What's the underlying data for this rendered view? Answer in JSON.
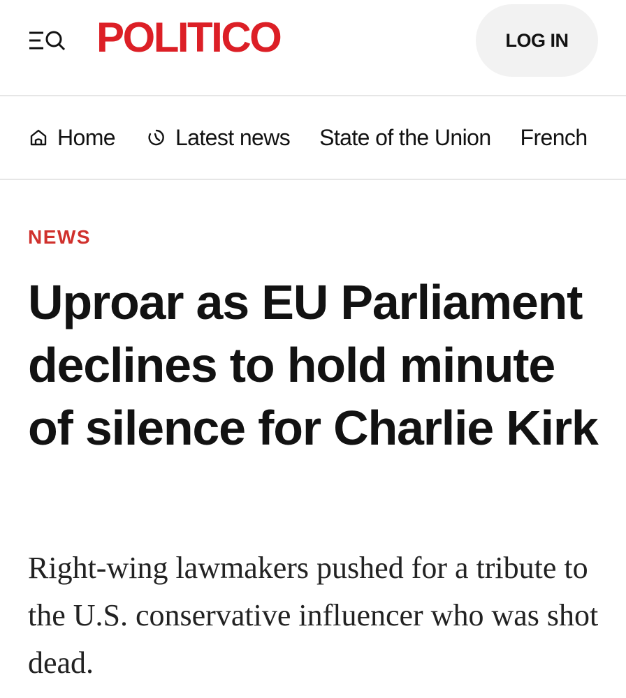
{
  "header": {
    "menu_icon": "menu-search-icon",
    "logo_text": "POLITICO",
    "login_label": "LOG IN",
    "brand_color": "#dc1f26"
  },
  "nav": {
    "items": [
      {
        "label": "Home",
        "icon": "home-icon"
      },
      {
        "label": "Latest news",
        "icon": "clock-icon"
      },
      {
        "label": "State of the Union",
        "icon": ""
      },
      {
        "label": "French",
        "icon": ""
      }
    ]
  },
  "article": {
    "kicker": "NEWS",
    "kicker_color": "#d0312d",
    "headline": "Uproar as EU Parliament declines to hold minute of silence for Charlie Kirk",
    "dek": "Right-wing lawmakers pushed for a tribute to the U.S. conservative influencer who was shot dead."
  }
}
